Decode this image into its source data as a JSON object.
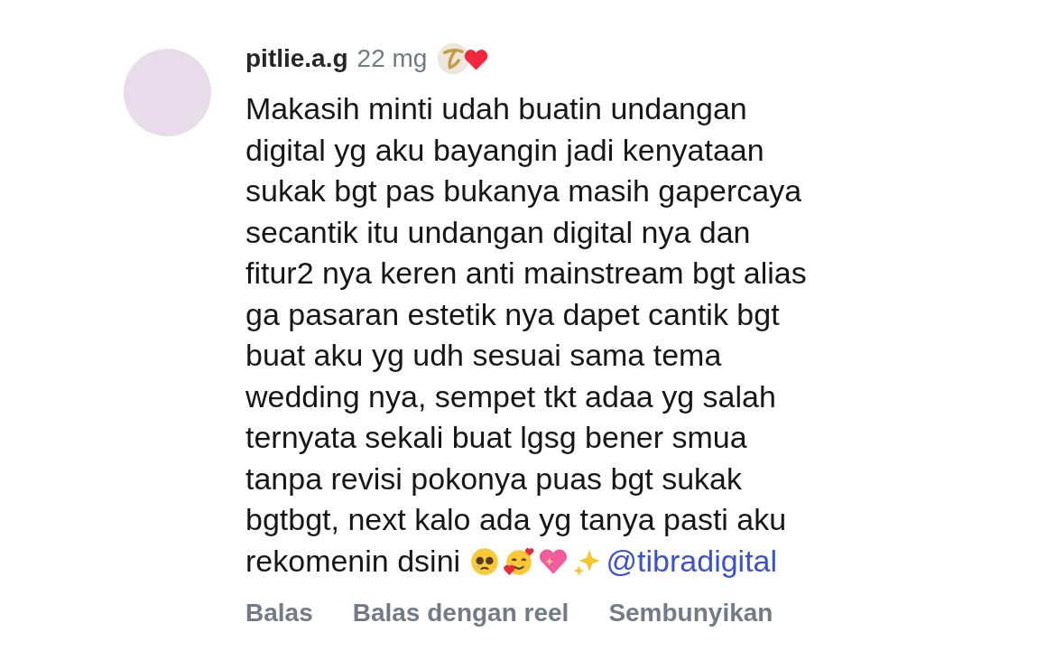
{
  "comment": {
    "username": "pitlie.a.g",
    "time": "22 mg",
    "text": "Makasih minti udah buatin undangan\ndigital yg aku bayangin jadi kenyataan\nsukak bgt pas bukanya masih gapercaya\nsecantik itu undangan digital nya dan\nfitur2 nya keren anti mainstream bgt alias\nga pasaran estetik nya dapet cantik bgt\nbuat aku yg udh sesuai sama tema\nwedding nya, sempet tkt adaa yg salah\nternyata sekali buat lgsg bener smua\ntanpa revisi pokonya puas bgt sukak\nbgtbgt, next kalo ada yg tanya pasti aku\nrekomenin dsini",
    "mention": "@tibradigital",
    "actions": [
      "Balas",
      "Balas dengan reel",
      "Sembunyikan"
    ]
  }
}
